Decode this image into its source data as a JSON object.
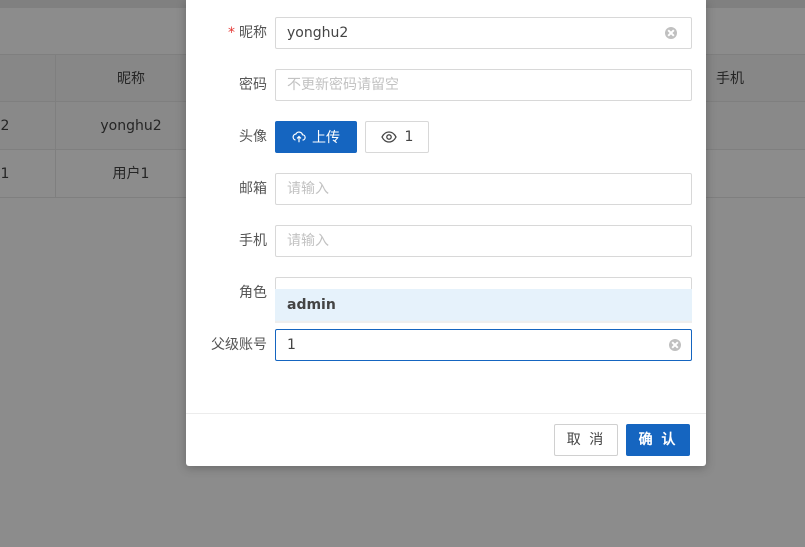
{
  "background_table": {
    "headers": {
      "nickname": "昵称",
      "phone": "手机"
    },
    "rows": [
      {
        "id_fragment": "2",
        "nickname": "yonghu2"
      },
      {
        "id_fragment": "1",
        "nickname": "用户1"
      }
    ]
  },
  "form": {
    "nickname": {
      "label": "昵称",
      "required": true,
      "value": "yonghu2"
    },
    "password": {
      "label": "密码",
      "placeholder": "不更新密码请留空"
    },
    "avatar": {
      "label": "头像",
      "upload_label": "上传",
      "preview_count": "1"
    },
    "email": {
      "label": "邮箱",
      "placeholder": "请输入"
    },
    "phone": {
      "label": "手机",
      "placeholder": "请输入"
    },
    "role": {
      "label": "角色",
      "dropdown_options": [
        "admin"
      ]
    },
    "parent_account": {
      "label": "父级账号",
      "value": "1"
    }
  },
  "footer": {
    "cancel_label": "取 消",
    "ok_label": "确 认"
  },
  "colors": {
    "primary": "#1565c0",
    "required": "#e53935",
    "option_highlight": "#e6f2fb"
  },
  "icons": {
    "upload": "cloud-upload-icon",
    "preview": "eye-icon",
    "clear": "close-circle-icon"
  }
}
